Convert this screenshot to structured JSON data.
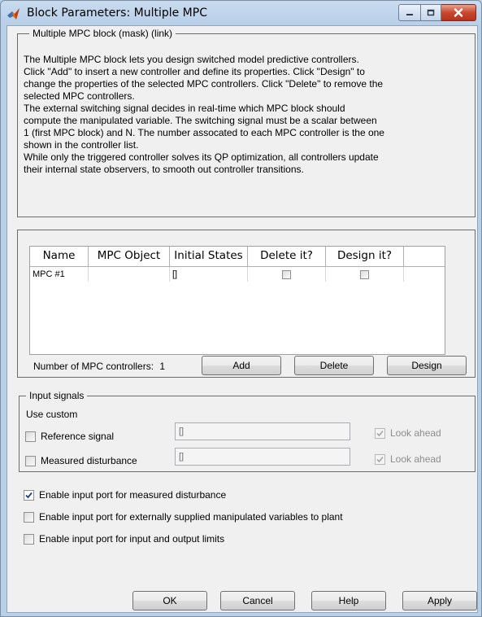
{
  "window": {
    "title": "Block Parameters: Multiple MPC"
  },
  "mask_group": {
    "title": "Multiple MPC block (mask) (link)",
    "description_lines": [
      "The Multiple MPC block lets you design switched model predictive controllers.",
      "Click \"Add\" to insert a new controller and define its properties. Click \"Design\" to",
      "change the properties of the selected MPC controllers. Click \"Delete\" to remove the",
      "selected MPC controllers.",
      "The external switching signal decides in real-time which MPC block should",
      "compute the manipulated variable. The switching signal must be a scalar between",
      "1 (first MPC block) and N. The number assocated to each MPC controller is the one",
      "shown in the controller list.",
      "While only the triggered controller solves its QP optimization, all controllers update",
      "their internal state observers, to smooth out controller transitions."
    ]
  },
  "controllers_table": {
    "columns": [
      "Name",
      "MPC Object",
      "Initial States",
      "Delete it?",
      "Design it?"
    ],
    "rows": [
      {
        "name": "MPC #1",
        "mpc_object": "",
        "initial_states": "[]",
        "delete": false,
        "design": false
      }
    ]
  },
  "controllers": {
    "count_label": "Number of MPC controllers:",
    "count": "1",
    "add_label": "Add",
    "delete_label": "Delete",
    "design_label": "Design"
  },
  "input_signals": {
    "title": "Input signals",
    "use_custom_label": "Use custom",
    "reference_label": "Reference signal",
    "reference_value": "[]",
    "reference_checked": false,
    "reference_lookahead_label": "Look ahead",
    "reference_lookahead_checked": true,
    "measured_label": "Measured disturbance",
    "measured_value": "[]",
    "measured_checked": false,
    "measured_lookahead_label": "Look ahead",
    "measured_lookahead_checked": true
  },
  "options": [
    {
      "label": "Enable input port for measured disturbance",
      "checked": true
    },
    {
      "label": "Enable input port for externally supplied manipulated variables to plant",
      "checked": false
    },
    {
      "label": "Enable input port for input and output limits",
      "checked": false
    }
  ],
  "footer": {
    "ok_label": "OK",
    "cancel_label": "Cancel",
    "help_label": "Help",
    "apply_label": "Apply"
  },
  "icons": {
    "app": "matlab-logo-icon",
    "minimize": "minimize-icon",
    "maximize": "maximize-icon",
    "close": "close-icon",
    "check": "checkmark-icon"
  },
  "colors": {
    "title_bar": "#c9dbef",
    "close_button": "#c8482f",
    "dialog_background": "#f0f0f0"
  }
}
